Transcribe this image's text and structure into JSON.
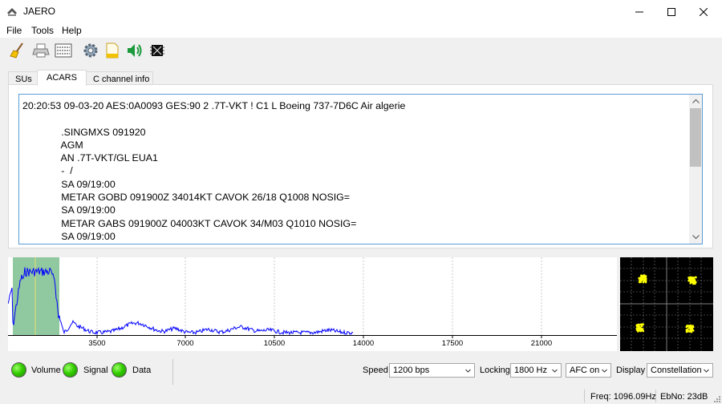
{
  "window": {
    "title": "JAERO",
    "controls": {
      "minimize": "minimize-icon",
      "maximize": "maximize-icon",
      "close": "close-icon"
    }
  },
  "menu": {
    "items": [
      "File",
      "Tools",
      "Help"
    ]
  },
  "toolbar": {
    "icons": [
      "broom-icon",
      "printer-icon",
      "binary-data-icon",
      "gear-icon",
      "document-icon",
      "speaker-icon",
      "chip-icon"
    ]
  },
  "tabs": [
    "SUs",
    "ACARS",
    "C channel info"
  ],
  "active_tab": "ACARS",
  "acars_log": {
    "lines": [
      "20:20:53 09-03-20 AES:0A0093 GES:90 2 .7T-VKT ! C1 L Boeing 737-7D6C Air algerie",
      "",
      "              .SINGMXS 091920",
      "              AGM",
      "              AN .7T-VKT/GL EUA1",
      "              -  /",
      "              SA 09/19:00",
      "              METAR GOBD 091900Z 34014KT CAVOK 26/18 Q1008 NOSIG=",
      "              SA 09/19:00",
      "              METAR GABS 091900Z 04003KT CAVOK 34/M03 Q1010 NOSIG=",
      "              SA 09/19:00"
    ]
  },
  "spectrum": {
    "x_ticks": [
      "3500",
      "7000",
      "10500",
      "14000",
      "17500",
      "21000"
    ],
    "colors": {
      "trace": "#0000ff",
      "passband": "#90c8a0",
      "grid": "#c8c8c8"
    }
  },
  "constellation": {
    "colors": {
      "background": "#000000",
      "points": "#ffff00",
      "grid": "#808080"
    }
  },
  "indicators": {
    "volume": {
      "label": "Volume",
      "state": "on"
    },
    "signal": {
      "label": "Signal",
      "state": "on"
    },
    "data": {
      "label": "Data",
      "state": "on"
    }
  },
  "controls": {
    "speed_label": "Speed",
    "speed_value": "1200 bps",
    "locking_label": "Locking",
    "locking_value": "1800 Hz",
    "afc_value": "AFC on",
    "display_label": "Display",
    "display_value": "Constellation"
  },
  "statusbar": {
    "freq": "Freq: 1096.09Hz",
    "ebno": "EbNo: 23dB"
  }
}
